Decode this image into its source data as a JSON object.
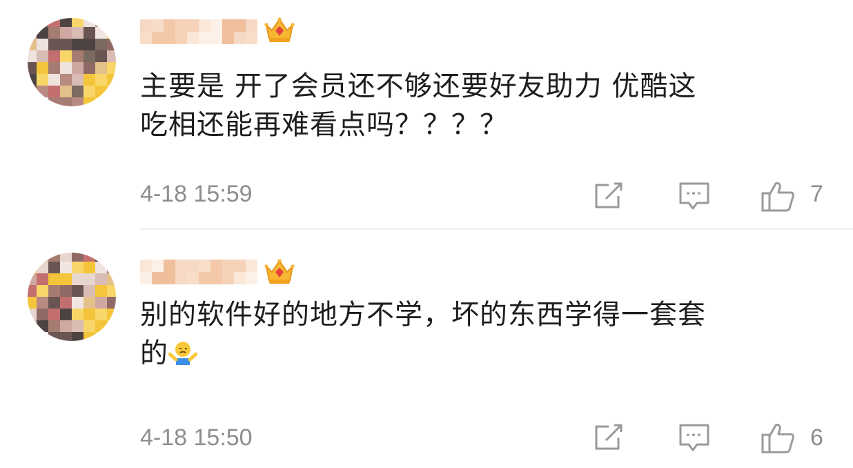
{
  "comments": [
    {
      "content_lines": [
        "主要是 开了会员还不够还要好友助力 优酷这",
        "吃相还能再难看点吗？？？？"
      ],
      "time": "4-18 15:59",
      "like_count": "7",
      "emoji_icon": "",
      "icons": {
        "badge": "crown-icon",
        "repost": "repost-icon",
        "reply": "comment-icon",
        "like": "thumbs-up-icon"
      }
    },
    {
      "content_lines": [
        "别的软件好的地方不学，坏的东西学得一套套",
        "的"
      ],
      "time": "4-18 15:50",
      "like_count": "6",
      "emoji_icon": "shrug-emoji-icon",
      "icons": {
        "badge": "crown-icon",
        "repost": "repost-icon",
        "reply": "comment-icon",
        "like": "thumbs-up-icon"
      }
    }
  ],
  "colors": {
    "text": "#1e1e1e",
    "meta": "#8e8e8e",
    "crown": "#f5a623",
    "gem": "#e8413c",
    "icon": "#9a9a9a"
  }
}
